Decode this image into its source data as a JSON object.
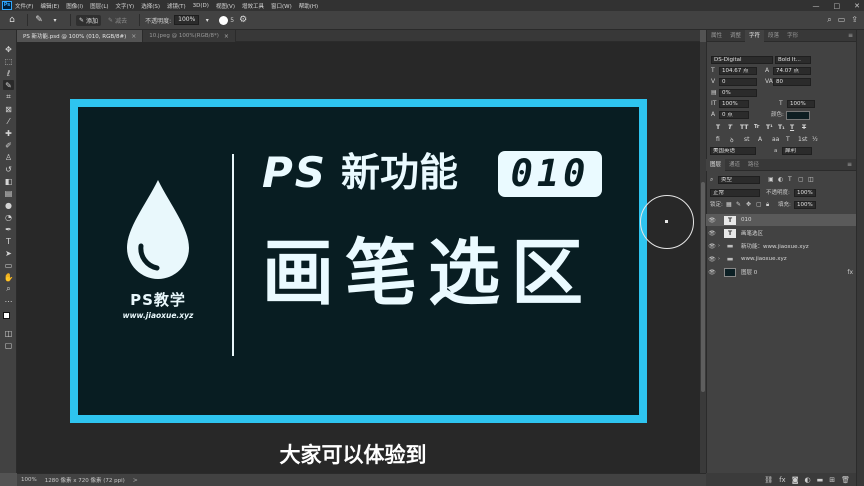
{
  "menubar": {
    "logo": "Ps",
    "items": [
      "文件(F)",
      "编辑(E)",
      "图像(I)",
      "图层(L)",
      "文字(Y)",
      "选择(S)",
      "滤镜(T)",
      "3D(D)",
      "视图(V)",
      "增效工具",
      "窗口(W)",
      "帮助(H)"
    ],
    "controls": [
      "—",
      "□",
      "✕"
    ]
  },
  "options": {
    "add_label": "添加",
    "subtract_label": "减去",
    "opacity_label": "不透明度:",
    "opacity_value": "100%",
    "brush_size": "5"
  },
  "tabs": [
    {
      "label": "PS 新功能.psd @ 100% (010, RGB/8#)",
      "close": "×"
    },
    {
      "label": "10.jpeg @ 100%(RGB/8*)",
      "close": "×"
    }
  ],
  "canvas": {
    "brand_name": "PS教学",
    "brand_url": "www.jiaoxue.xyz",
    "headline_ps": "PS",
    "headline_cn": "新功能",
    "badge": "010",
    "title": "画笔选区",
    "colors": {
      "frame": "#2ec4ef",
      "bg": "#081d22",
      "text": "#eafaff"
    }
  },
  "subtitle": "大家可以体验到",
  "status": {
    "zoom": "100%",
    "doc_info": "1280 像素 x 720 像素 (72 ppi)",
    "arrow": ">"
  },
  "panel_tabs": {
    "top": [
      "属性",
      "调整",
      "字符",
      "段落",
      "字形"
    ],
    "layers": [
      "图层",
      "通道",
      "路径"
    ]
  },
  "character": {
    "font_family": "DS-Digital",
    "font_style": "Bold It...",
    "font_size": "104.67 点",
    "leading": "74.07 点",
    "kerning": "0",
    "tracking": "80",
    "vscale_label": "0%",
    "vert_scale": "100%",
    "horiz_scale": "100%",
    "baseline": "0 点",
    "color_label": "颜色:",
    "language": "美国英语",
    "aa_label": "a",
    "aa_mode": "犀利"
  },
  "layers": {
    "filter_label": "类型",
    "blend_mode": "正常",
    "opacity_label": "不透明度:",
    "opacity_value": "100%",
    "lock_label": "锁定:",
    "fill_label": "填充:",
    "fill_value": "100%",
    "rows": [
      {
        "name": "010",
        "type": "text"
      },
      {
        "name": "画笔选区",
        "type": "text"
      },
      {
        "name": "新功能：www.jiaoxue.xyz",
        "type": "folder"
      },
      {
        "name": "www.jiaoxue.xyz",
        "type": "folder"
      },
      {
        "name": "图层 0",
        "type": "image",
        "fx": "fx"
      }
    ]
  }
}
